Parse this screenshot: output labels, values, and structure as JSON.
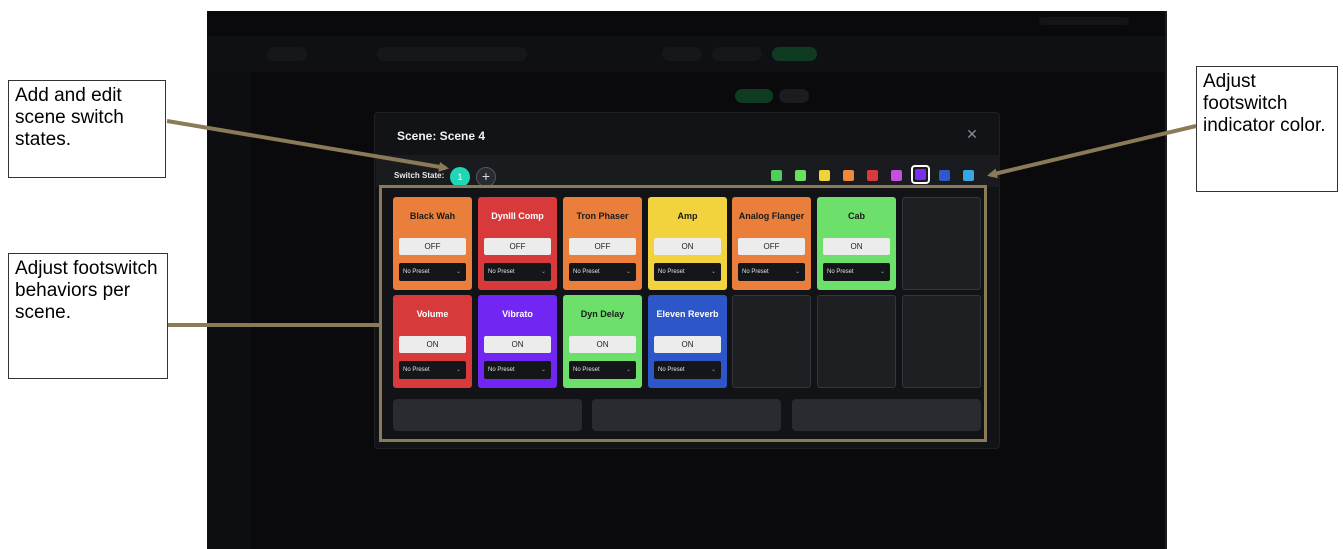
{
  "modal": {
    "title": "Scene: Scene 4",
    "close_icon": "close-icon",
    "switch_state_label": "Switch State:",
    "active_state": "1",
    "add_state_icon": "plus-icon",
    "add_state_glyph": "+"
  },
  "colors": {
    "swatches": [
      "#4fce5a",
      "#6ae05e",
      "#f0d23a",
      "#ef8a3c",
      "#d63a3a",
      "#c64ee0",
      "#7a2cf0",
      "#2f59c9",
      "#3aa6e0"
    ],
    "selected_index": 6,
    "accent": "#1fd6b5",
    "highlight": "#8a7a57"
  },
  "grid": {
    "row1": [
      {
        "name": "Black Wah",
        "state": "OFF",
        "preset": "No Preset",
        "color": "#ea7f3c",
        "text": "#1a1a1a"
      },
      {
        "name": "DynIII Comp",
        "state": "OFF",
        "preset": "No Preset",
        "color": "#d8393b",
        "text": "#ffffff"
      },
      {
        "name": "Tron Phaser",
        "state": "OFF",
        "preset": "No Preset",
        "color": "#ea7f3c",
        "text": "#1a1a1a"
      },
      {
        "name": "Amp",
        "state": "ON",
        "preset": "No Preset",
        "color": "#f3d33d",
        "text": "#1a1a1a"
      },
      {
        "name": "Analog Flanger",
        "state": "OFF",
        "preset": "No Preset",
        "color": "#ea7f3c",
        "text": "#1a1a1a"
      },
      {
        "name": "Cab",
        "state": "ON",
        "preset": "No Preset",
        "color": "#6ce06a",
        "text": "#1a1a1a"
      }
    ],
    "row2": [
      {
        "name": "Volume",
        "state": "ON",
        "preset": "No Preset",
        "color": "#d8393b",
        "text": "#ffffff"
      },
      {
        "name": "Vibrato",
        "state": "ON",
        "preset": "No Preset",
        "color": "#7126f3",
        "text": "#ffffff"
      },
      {
        "name": "Dyn Delay",
        "state": "ON",
        "preset": "No Preset",
        "color": "#6ce06a",
        "text": "#1a1a1a"
      },
      {
        "name": "Eleven Reverb",
        "state": "ON",
        "preset": "No Preset",
        "color": "#2d57c9",
        "text": "#ffffff"
      }
    ]
  },
  "callouts": {
    "switch_states": "Add and edit scene switch states.",
    "indicator_color": "Adjust footswitch indicator color.",
    "behaviors": "Adjust footswitch behaviors per scene."
  }
}
